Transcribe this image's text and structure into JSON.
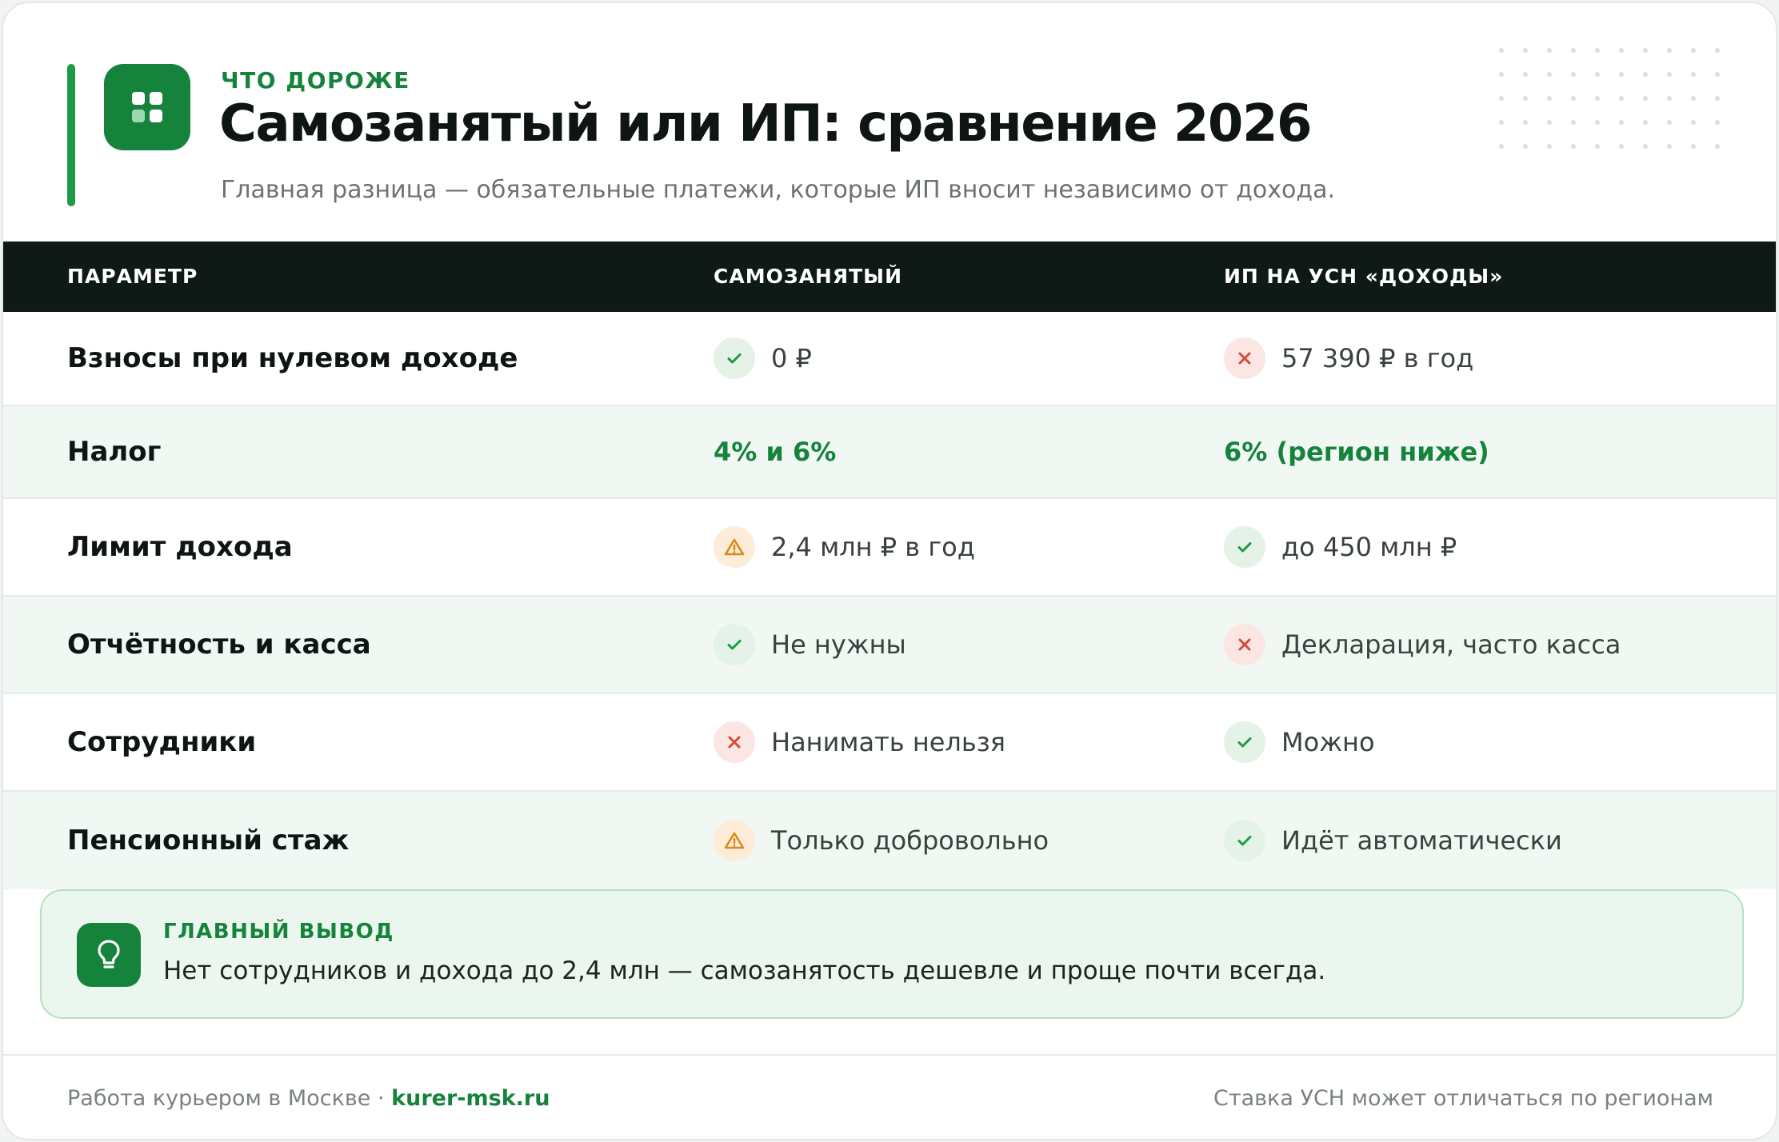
{
  "header": {
    "eyebrow": "ЧТО ДОРОЖЕ",
    "title": "Самозанятый или ИП: сравнение 2026",
    "subtitle": "Главная разница — обязательные платежи, которые ИП вносит независимо от дохода.",
    "logo_icon": "grid-icon"
  },
  "table": {
    "columns": [
      "ПАРАМЕТР",
      "САМОЗАНЯТЫЙ",
      "ИП НА УСН «ДОХОДЫ»"
    ],
    "rows": [
      {
        "param": "Взносы при нулевом доходе",
        "self": {
          "status": "ok",
          "icon": "check-icon",
          "text": "0 ₽"
        },
        "ip": {
          "status": "no",
          "icon": "cross-icon",
          "text": "57 390 ₽ в год"
        }
      },
      {
        "param": "Налог",
        "self": {
          "status": "highlight",
          "text": "4% и 6%"
        },
        "ip": {
          "status": "highlight",
          "text": "6% (регион ниже)"
        }
      },
      {
        "param": "Лимит дохода",
        "self": {
          "status": "warn",
          "icon": "warning-icon",
          "text": "2,4 млн ₽ в год"
        },
        "ip": {
          "status": "ok",
          "icon": "check-icon",
          "text": "до 450 млн ₽"
        }
      },
      {
        "param": "Отчётность и касса",
        "self": {
          "status": "ok",
          "icon": "check-icon",
          "text": "Не нужны"
        },
        "ip": {
          "status": "no",
          "icon": "cross-icon",
          "text": "Декларация, часто касса"
        }
      },
      {
        "param": "Сотрудники",
        "self": {
          "status": "no",
          "icon": "cross-icon",
          "text": "Нанимать нельзя"
        },
        "ip": {
          "status": "ok",
          "icon": "check-icon",
          "text": "Можно"
        }
      },
      {
        "param": "Пенсионный стаж",
        "self": {
          "status": "warn",
          "icon": "warning-icon",
          "text": "Только добровольно"
        },
        "ip": {
          "status": "ok",
          "icon": "check-icon",
          "text": "Идёт автоматически"
        }
      }
    ]
  },
  "conclusion": {
    "label": "ГЛАВНЫЙ ВЫВОД",
    "text": "Нет сотрудников и дохода до 2,4 млн — самозанятость дешевле и проще почти всегда.",
    "icon": "lightbulb-icon"
  },
  "footer": {
    "left_text": "Работа курьером в Москве · ",
    "site": "kurer-msk.ru",
    "right_text": "Ставка УСН может отличаться по регионам"
  },
  "colors": {
    "accent": "#16833d",
    "header_bg": "#0f1a16",
    "ok": "#1f9a48",
    "no": "#d64a3a",
    "warn": "#d98a1c"
  }
}
